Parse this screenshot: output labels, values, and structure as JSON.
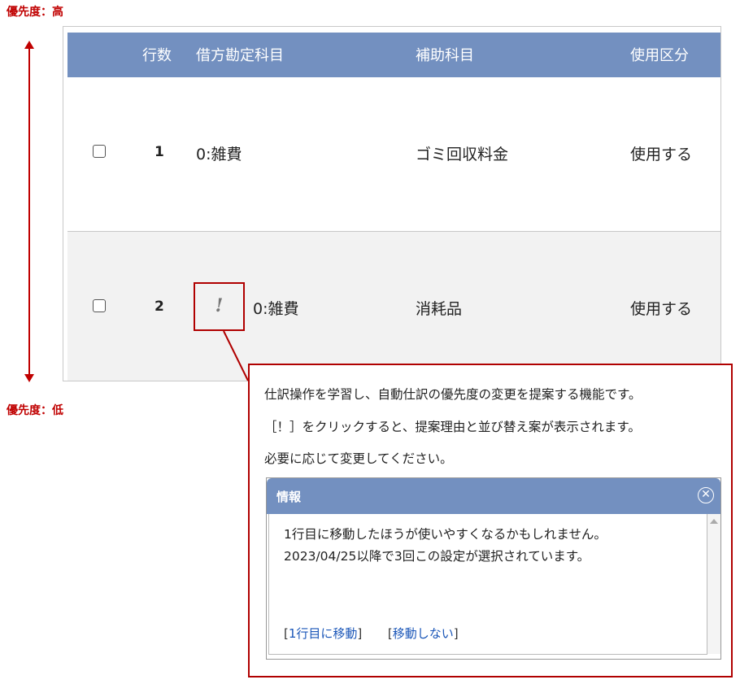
{
  "priority": {
    "high": "優先度：高",
    "low": "優先度：低"
  },
  "table": {
    "headers": [
      "行数",
      "借方勘定科目",
      "補助科目",
      "使用区分"
    ],
    "rows": [
      {
        "line": "1",
        "account": "0:雑費",
        "sub_account": "ゴミ回収料金",
        "usage": "使用する"
      },
      {
        "line": "2",
        "account": "0:雑費",
        "sub_account": "消耗品",
        "usage": "使用する"
      }
    ],
    "alert_mark": "!"
  },
  "callout": {
    "line1": "仕訳操作を学習し、自動仕訳の優先度の変更を提案する機能です。",
    "line2": "［！］をクリックすると、提案理由と並び替え案が表示されます。",
    "line3": "必要に応じて変更してください。"
  },
  "dialog": {
    "title": "情報",
    "message1": "1行目に移動したほうが使いやすくなるかもしれません。",
    "message2": "2023/04/25以降で3回この設定が選択されています。",
    "move_link": "1行目に移動",
    "no_move_link": "移動しない",
    "bracket_open": "[",
    "bracket_close": "]"
  },
  "colors": {
    "header_bg": "#7390c0",
    "highlight": "#b00000"
  }
}
